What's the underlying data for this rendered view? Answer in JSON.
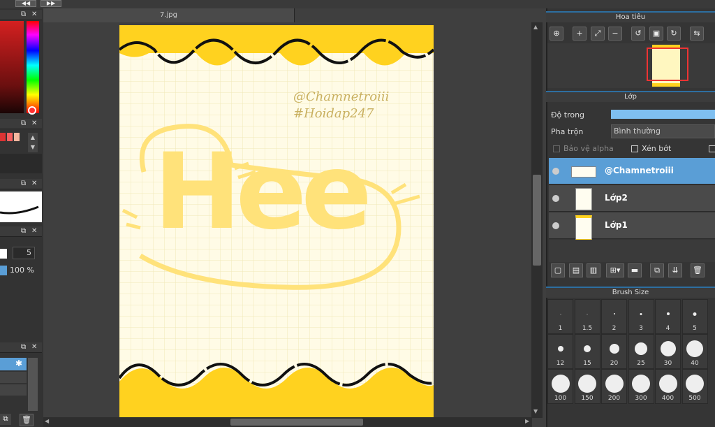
{
  "top": {
    "btn1": "◀◀",
    "btn2": "▶▶"
  },
  "document": {
    "tab_title": "7.jpg"
  },
  "artwork": {
    "watermark_line1": "@Chamnetroiii",
    "watermark_line2": "#Hoidap247",
    "big_text": "Hee"
  },
  "left_panels": {
    "brush_size_value": "5",
    "opacity_value": "100 %"
  },
  "navigator": {
    "title": "Hoa tiêu"
  },
  "layers_panel": {
    "title": "Lớp",
    "opacity_label": "Độ trong",
    "blend_label": "Pha trộn",
    "blend_value": "Bình thường",
    "protect_alpha": "Bảo vệ alpha",
    "clipping": "Xén bớt",
    "layers": [
      {
        "name": "@Chamnetroiii"
      },
      {
        "name": "Lớp2"
      },
      {
        "name": "Lớp1"
      }
    ]
  },
  "brush_size": {
    "title": "Brush Size",
    "sizes": [
      "1",
      "1.5",
      "2",
      "3",
      "4",
      "5",
      "12",
      "15",
      "20",
      "25",
      "30",
      "40",
      "100",
      "150",
      "200",
      "300",
      "400",
      "500"
    ]
  },
  "colors": {
    "accent": "#5a9ed6",
    "canvas_yellow": "#ffd21f",
    "paper": "#fffbe6"
  }
}
